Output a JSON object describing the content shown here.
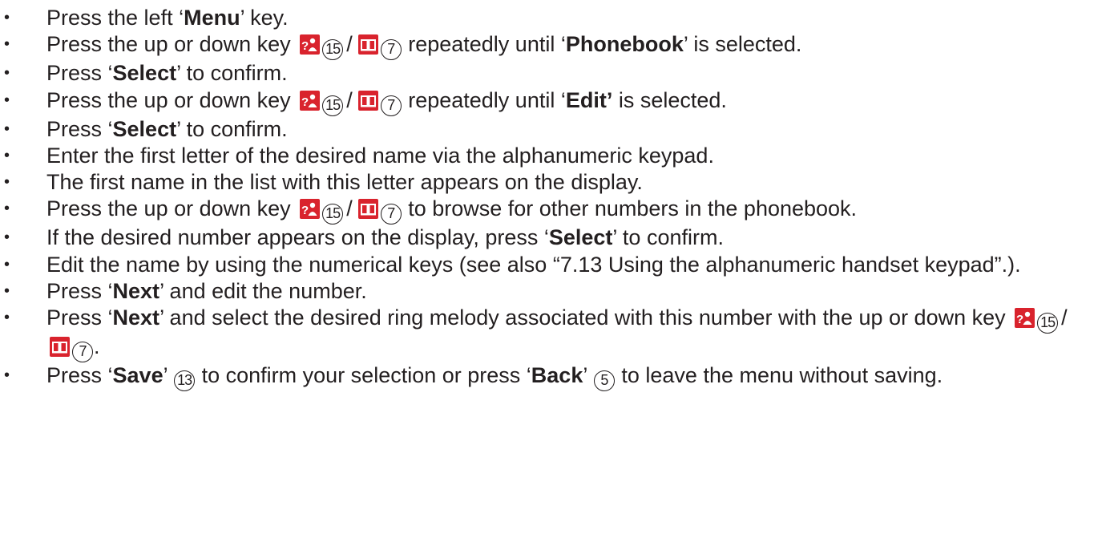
{
  "steps": [
    {
      "pre": "Press the left ‘",
      "bold": "Menu",
      "post": "’ key."
    },
    {
      "pre": "Press the up or down key",
      "icons": true,
      "key_up_num": "15",
      "key_down_num": "7",
      "mid": "repeatedly until ‘",
      "bold": "Phonebook",
      "post": "’ is selected."
    },
    {
      "pre": "Press ‘",
      "bold": "Select",
      "post": "’ to confirm."
    },
    {
      "pre": "Press the up or down key",
      "icons": true,
      "key_up_num": "15",
      "key_down_num": "7",
      "mid": "repeatedly until ‘",
      "bold": "Edit’",
      "post": " is selected."
    },
    {
      "pre": "Press ‘",
      "bold": "Select",
      "post": "’ to confirm."
    },
    {
      "text": "Enter the first letter of the desired name via the alphanumeric keypad."
    },
    {
      "text": "The first name in the list with this letter appears on the display."
    },
    {
      "pre": "Press the up or down key",
      "icons": true,
      "key_up_num": "15",
      "key_down_num": "7",
      "mid": "to browse for other numbers in the phonebook."
    },
    {
      "pre": "If the desired number appears on the display, press ‘",
      "bold": "Select",
      "post": "’ to confirm."
    },
    {
      "text": "Edit the name by using the numerical keys (see also “7.13 Using the alphanumeric handset keypad”.)."
    },
    {
      "pre": "Press ‘",
      "bold": "Next",
      "post": "’ and edit the number."
    },
    {
      "pre": "Press ‘",
      "bold": "Next",
      "post": "’ and select the desired ring melody associated with this number with the up or down key",
      "icons_end": true,
      "key_up_num": "15",
      "key_down_num": "7",
      "end": "."
    },
    {
      "pre": "Press ‘",
      "bold": "Save",
      "post": "’",
      "num1": "13",
      "mid2": "to confirm your selection or press ‘",
      "bold2": "Back",
      "post2": "’",
      "num2": "5",
      "end": "to leave the menu without saving."
    }
  ],
  "bullet_char": "•",
  "colors": {
    "key_icon": "#d9232d",
    "text": "#231f20"
  },
  "icons": {
    "up_key": "contacts-help-icon",
    "down_key": "phonebook-icon"
  }
}
